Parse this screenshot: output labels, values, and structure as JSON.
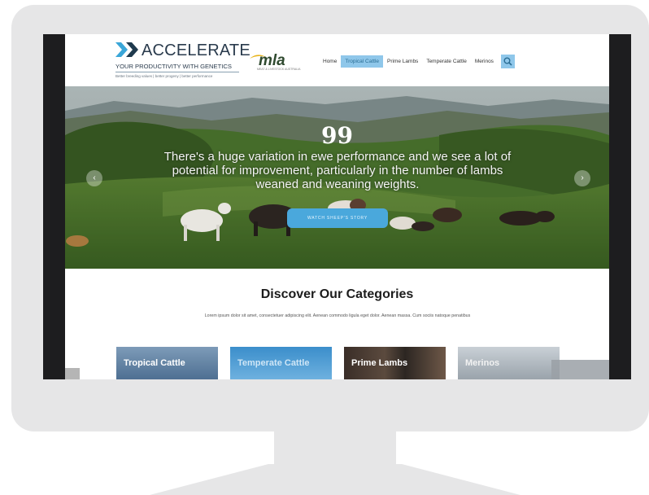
{
  "site": {
    "logo": {
      "title": "ACCELERATE",
      "subtitle": "YOUR PRODUCTIVITY WITH GENETICS",
      "tagline": "Better breeding values | better progeny | better performance",
      "partner": "mla",
      "partner_sub": "MEAT & LIVESTOCK AUSTRALIA"
    },
    "nav": {
      "items": [
        {
          "label": "Home"
        },
        {
          "label": "Tropical Cattle"
        },
        {
          "label": "Prime Lambs"
        },
        {
          "label": "Temperate Cattle"
        },
        {
          "label": "Merinos"
        }
      ],
      "active_color": "#8fc7ea"
    },
    "hero": {
      "quote_mark": "99",
      "quote": "There's a huge variation in ewe performance and we see a lot of potential for improvement, particularly in the number of lambs weaned and weaning weights.",
      "button": "WATCH SHEEP'S STORY",
      "prev_glyph": "‹",
      "next_glyph": "›"
    },
    "categories": {
      "title": "Discover Our Categories",
      "description": "Lorem ipsum dolor sit amet, consectetuer adipiscing elit. Aenean commodo ligula eget dolor. Aenean massa. Cum sociis natoque penatibus",
      "tiles": [
        {
          "label": "Tropical Cattle"
        },
        {
          "label": "Temperate Cattle"
        },
        {
          "label": "Prime Lambs"
        },
        {
          "label": "Merinos"
        }
      ]
    }
  },
  "colors": {
    "accent": "#4aa8dc",
    "monitor": "#e6e6e7",
    "brand_dark": "#2a3b4d"
  },
  "icons": [
    "chevron-double-right-icon",
    "search-icon",
    "quote-icon",
    "chevron-left-icon",
    "chevron-right-icon"
  ]
}
